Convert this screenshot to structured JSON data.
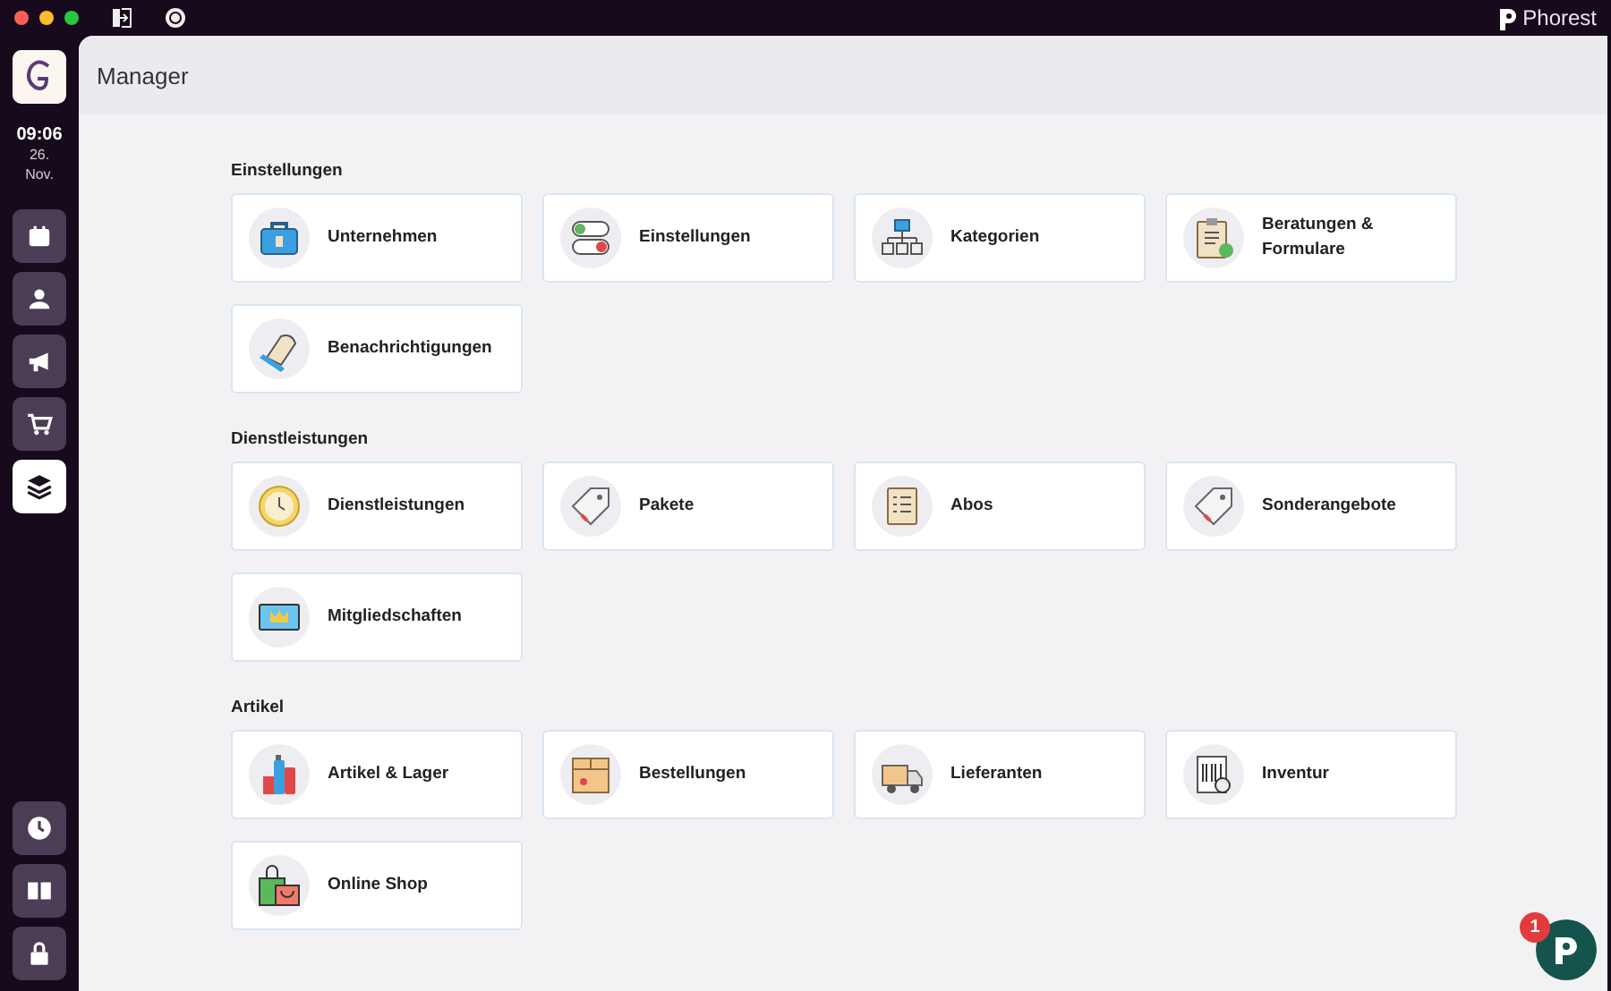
{
  "brand": {
    "name": "Phorest"
  },
  "sidebar": {
    "time": "09:06",
    "day": "26.",
    "month": "Nov.",
    "nav": [
      {
        "selected": false
      },
      {
        "selected": false
      },
      {
        "selected": false
      },
      {
        "selected": false
      },
      {
        "selected": true
      }
    ],
    "bottom_nav": [
      {
        "selected": false
      },
      {
        "selected": false
      },
      {
        "selected": false
      }
    ]
  },
  "page": {
    "title": "Manager"
  },
  "sections": [
    {
      "title": "Einstellungen",
      "items": [
        {
          "label": "Unternehmen"
        },
        {
          "label": "Einstellungen"
        },
        {
          "label": "Kategorien"
        },
        {
          "label": "Beratungen & Formulare"
        },
        {
          "label": "Benachrichtigungen"
        }
      ]
    },
    {
      "title": "Dienstleistungen",
      "items": [
        {
          "label": "Dienstleistungen"
        },
        {
          "label": "Pakete"
        },
        {
          "label": "Abos"
        },
        {
          "label": "Sonderangebote"
        },
        {
          "label": "Mitgliedschaften"
        }
      ]
    },
    {
      "title": "Artikel",
      "items": [
        {
          "label": "Artikel & Lager"
        },
        {
          "label": "Bestellungen"
        },
        {
          "label": "Lieferanten"
        },
        {
          "label": "Inventur"
        },
        {
          "label": "Online Shop"
        }
      ]
    }
  ],
  "chat": {
    "badge": "1"
  }
}
